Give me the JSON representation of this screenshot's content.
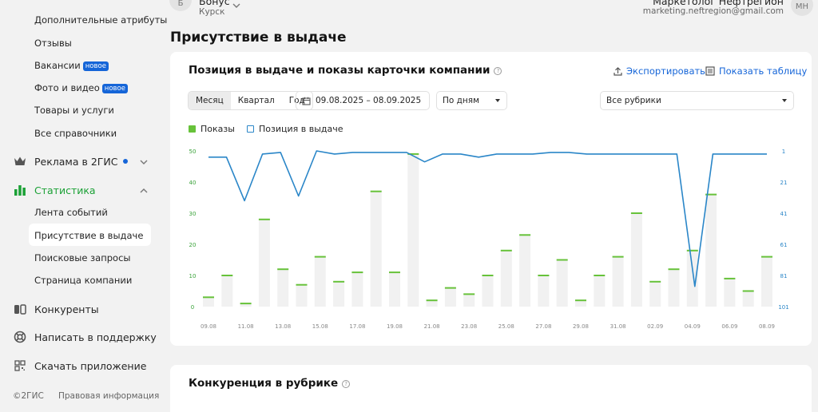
{
  "sidebar": {
    "sub_items_top": [
      {
        "label": "Дополнительные атрибуты",
        "badge": ""
      },
      {
        "label": "Отзывы",
        "badge": ""
      },
      {
        "label": "Вакансии",
        "badge": "новое"
      },
      {
        "label": "Фото и видео",
        "badge": "новое"
      },
      {
        "label": "Товары и услуги",
        "badge": ""
      },
      {
        "label": "Все справочники",
        "badge": ""
      }
    ],
    "ads": {
      "label": "Реклама в 2ГИС",
      "icon": "crown-icon"
    },
    "stats": {
      "label": "Статистика",
      "icon": "bar-chart-icon"
    },
    "stats_items": [
      {
        "label": "Лента событий"
      },
      {
        "label": "Присутствие в выдаче"
      },
      {
        "label": "Поисковые запросы"
      },
      {
        "label": "Страница компании"
      }
    ],
    "competitors": {
      "label": "Конкуренты",
      "icon": "competitors-icon"
    },
    "support": {
      "label": "Написать в поддержку",
      "icon": "lifebuoy-icon"
    },
    "download": {
      "label": "Скачать приложение",
      "icon": "qr-code-icon"
    },
    "footer": {
      "copyright": "©2ГИС",
      "legal": "Правовая информация"
    }
  },
  "header": {
    "company_initial": "Б",
    "company_name": "Бонус",
    "company_city": "Курск",
    "user_name": "Маркетолог Нефтрегион",
    "user_email": "marketing.neftregion@gmail.com",
    "user_initials": "МН"
  },
  "page": {
    "title": "Присутствие в выдаче"
  },
  "card1": {
    "title": "Позиция в выдаче и показы карточки компании",
    "export_label": "Экспортировать",
    "table_label": "Показать таблицу",
    "period_tabs": [
      "Месяц",
      "Квартал",
      "Год"
    ],
    "active_period": "Месяц",
    "date_range": "09.08.2025 – 08.09.2025",
    "granularity": "По дням",
    "rubric": "Все рубрики",
    "legend_views": "Показы",
    "legend_position": "Позиция в выдаче"
  },
  "card2": {
    "title": "Конкуренция в рубрике"
  },
  "colors": {
    "accent_green": "#1ba136",
    "link_blue": "#1565d8",
    "bar_green": "#67c23a",
    "line_blue": "#2a86c8"
  },
  "chart_data": {
    "type": "bar",
    "x_tick_labels": [
      "09.08",
      "11.08",
      "13.08",
      "15.08",
      "17.08",
      "19.08",
      "21.08",
      "23.08",
      "25.08",
      "27.08",
      "29.08",
      "31.08",
      "02.09",
      "04.09",
      "06.09",
      "08.09"
    ],
    "series": [
      {
        "name": "Показы",
        "axis": "left",
        "type": "bar",
        "values": [
          3,
          10,
          1,
          28,
          12,
          7,
          16,
          8,
          11,
          37,
          11,
          49,
          2,
          6,
          4,
          10,
          18,
          23,
          10,
          15,
          2,
          10,
          16,
          30,
          8,
          12,
          18,
          36,
          9,
          5,
          16
        ]
      },
      {
        "name": "Позиция в выдаче",
        "axis": "right",
        "type": "line",
        "values": [
          5,
          5,
          33,
          3,
          2,
          30,
          1,
          3,
          2,
          2,
          2,
          2,
          8,
          3,
          3,
          5,
          3,
          3,
          3,
          2,
          2,
          3,
          3,
          3,
          3,
          3,
          3,
          88,
          3,
          3,
          3,
          3
        ]
      }
    ],
    "y_left": {
      "min": 0,
      "max": 50,
      "ticks": [
        0,
        10,
        20,
        30,
        40,
        50
      ]
    },
    "y_right": {
      "min": 1,
      "max": 101,
      "ticks": [
        1,
        21,
        41,
        61,
        81,
        101
      ],
      "reversed": true
    }
  }
}
